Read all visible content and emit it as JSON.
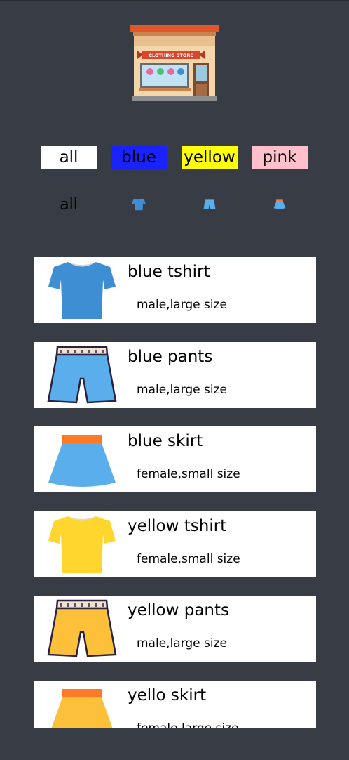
{
  "logo": {
    "sign_text": "CLOTHING STORE"
  },
  "filters": [
    {
      "label": "all",
      "color": "#ffffff"
    },
    {
      "label": "blue",
      "color": "#1a23ff"
    },
    {
      "label": "yellow",
      "color": "#ffff0a"
    },
    {
      "label": "pink",
      "color": "#ffc0cb"
    }
  ],
  "icon_filters": [
    {
      "label": "all",
      "icon": "all-text"
    },
    {
      "icon": "tshirt-icon"
    },
    {
      "icon": "pants-icon"
    },
    {
      "icon": "skirt-icon"
    }
  ],
  "items": [
    {
      "name": "blue tshirt",
      "desc": "male,large size",
      "icon": "tshirt-icon",
      "color": "#3d8ed3"
    },
    {
      "name": "blue pants",
      "desc": "male,large size",
      "icon": "pants-icon",
      "color": "#5aaeec"
    },
    {
      "name": "blue skirt",
      "desc": "female,small size",
      "icon": "skirt-icon",
      "color": "#5aaeec"
    },
    {
      "name": "yellow tshirt",
      "desc": "female,small size",
      "icon": "tshirt-icon",
      "color": "#ffd62e"
    },
    {
      "name": "yellow pants",
      "desc": "male,large size",
      "icon": "pants-icon",
      "color": "#fcc03b"
    },
    {
      "name": "yello skirt",
      "desc": "female,large size",
      "icon": "skirt-icon",
      "color": "#fcc03b"
    }
  ]
}
